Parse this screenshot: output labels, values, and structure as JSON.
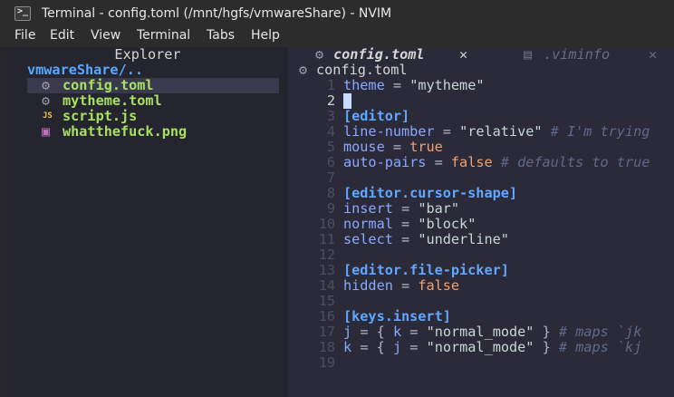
{
  "window": {
    "title": "Terminal - config.toml (/mnt/hgfs/vmwareShare) - NVIM"
  },
  "menubar": {
    "items": [
      "File",
      "Edit",
      "View",
      "Terminal",
      "Tabs",
      "Help"
    ]
  },
  "explorer": {
    "header": "Explorer",
    "root": "vmwareShare/..",
    "files": [
      {
        "name": "config.toml",
        "icon": "gear-icon",
        "selected": true
      },
      {
        "name": "mytheme.toml",
        "icon": "gear-icon",
        "selected": false
      },
      {
        "name": "script.js",
        "icon": "js-file-icon",
        "icon_text": "JS",
        "selected": false
      },
      {
        "name": "whatthefuck.png",
        "icon": "image-file-icon",
        "selected": false
      }
    ]
  },
  "tabs": [
    {
      "name": "config.toml",
      "icon": "gear-icon",
      "active": true,
      "close": "✕"
    },
    {
      "name": ".viminfo",
      "icon": "document-icon",
      "active": false,
      "close": "✕"
    }
  ],
  "buffer": {
    "filename": "config.toml",
    "lines": [
      "theme = \"mytheme\"",
      "",
      "[editor]",
      "line-number = \"relative\" # I'm trying",
      "mouse = true",
      "auto-pairs = false # defaults to true",
      "",
      "[editor.cursor-shape]",
      "insert = \"bar\"",
      "normal = \"block\"",
      "select = \"underline\"",
      "",
      "[editor.file-picker]",
      "hidden = false",
      "",
      "[keys.insert]",
      "j = { k = \"normal_mode\" } # maps `jk",
      "k = { j = \"normal_mode\" } # maps `kj",
      ""
    ],
    "line_numbers": [
      "1",
      "2",
      "3",
      "4",
      "5",
      "6",
      "7",
      "8",
      "9",
      "10",
      "11",
      "12",
      "13",
      "14",
      "15",
      "16",
      "17",
      "18",
      "19"
    ],
    "cursor_line": 2
  },
  "colors": {
    "key": "#8aa8ff",
    "string": "#c6d8d3",
    "bool": "#f5a06e",
    "comment": "#5e6a8a",
    "header": "#61a6ff",
    "file": "#a8e060",
    "dir": "#5aa8ff"
  }
}
